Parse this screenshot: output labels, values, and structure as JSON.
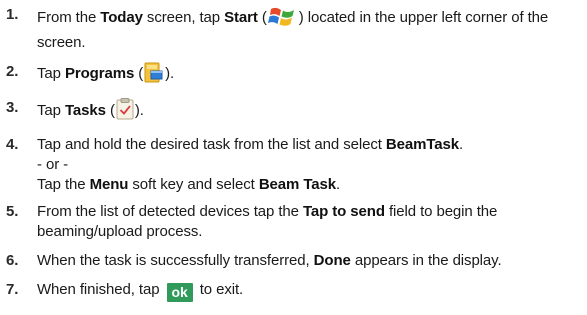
{
  "steps": [
    {
      "number": "1.",
      "text_1": "From the ",
      "bold_1": "Today",
      "text_2": " screen, tap ",
      "bold_2": "Start",
      "text_3": " (",
      "icon": "windows-start-icon",
      "text_4": ") located in the upper left corner of the screen."
    },
    {
      "number": "2.",
      "text_1": "Tap ",
      "bold_1": "Programs",
      "text_2": " (",
      "icon": "programs-folder-icon",
      "text_3": ")."
    },
    {
      "number": "3.",
      "text_1": "Tap ",
      "bold_1": "Tasks",
      "text_2": " (",
      "icon": "tasks-clipboard-icon",
      "text_3": ")."
    },
    {
      "number": "4.",
      "text_1": "Tap and hold the desired task from the list and select ",
      "bold_1": "BeamTask",
      "text_2": ".",
      "or_line": "- or -",
      "alt_text_1": "Tap the ",
      "alt_bold_1": "Menu",
      "alt_text_2": " soft key and select ",
      "alt_bold_2": "Beam Task",
      "alt_text_3": "."
    },
    {
      "number": "5.",
      "text_1": "From the list of detected devices tap the ",
      "bold_1": "Tap to send",
      "text_2": " field to begin the beaming/upload process."
    },
    {
      "number": "6.",
      "text_1": "When the task is successfully transferred, ",
      "bold_1": "Done",
      "text_2": " appears in the display."
    },
    {
      "number": "7.",
      "text_1": "When finished, tap ",
      "button_label": "ok",
      "text_2": " to exit."
    }
  ],
  "colors": {
    "ok_button": "#2f9a5a",
    "text": "#1a1a1a"
  }
}
